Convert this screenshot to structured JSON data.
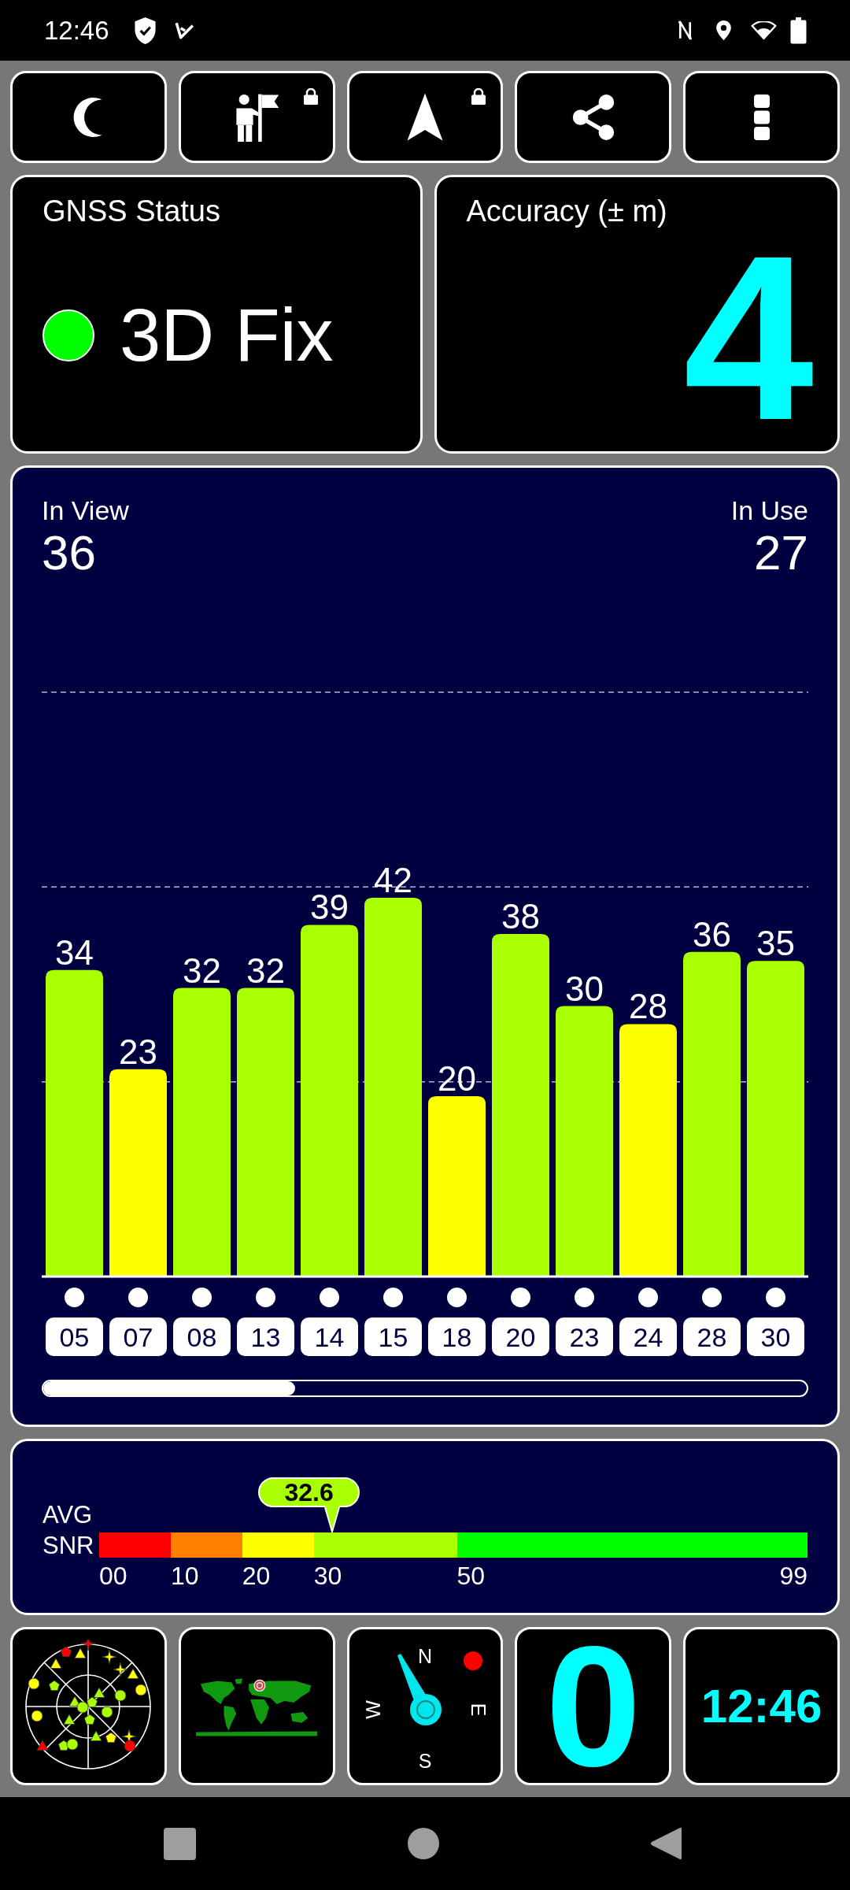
{
  "status_bar": {
    "time": "12:46"
  },
  "toolbar": [
    {
      "locked": false
    },
    {
      "locked": true
    },
    {
      "locked": true
    },
    {
      "locked": false
    },
    {
      "locked": false
    }
  ],
  "gnss_status": {
    "title": "GNSS Status",
    "value": "3D Fix",
    "color": "#00ff00"
  },
  "accuracy": {
    "title": "Accuracy (± m)",
    "value": "4"
  },
  "satellites": {
    "in_view_label": "In View",
    "in_view": "36",
    "in_use_label": "In Use",
    "in_use": "27",
    "chart_data": {
      "type": "bar",
      "categories": [
        "05",
        "07",
        "08",
        "13",
        "14",
        "15",
        "18",
        "20",
        "23",
        "24",
        "28",
        "30"
      ],
      "series": [
        {
          "color": "#aaff00",
          "values": [
            34,
            null,
            32,
            32,
            39,
            42,
            null,
            38,
            30,
            null,
            36,
            35
          ]
        },
        {
          "color": "#ffff00",
          "values": [
            null,
            23,
            null,
            null,
            null,
            null,
            20,
            null,
            null,
            28,
            null,
            null
          ]
        }
      ],
      "stacked": true,
      "data_labels": true,
      "ref_lines": [
        {
          "axis": "y",
          "value": 21.6
        },
        {
          "axis": "y",
          "value": 43.2
        },
        {
          "axis": "y",
          "value": 64.8
        }
      ]
    }
  },
  "snr": {
    "label": "AVG SNR",
    "average": {
      "value": "32.6",
      "level": 0.329
    },
    "scale": [
      {
        "color": "#ff0000"
      },
      {
        "color": "#ff8000"
      },
      {
        "color": "#ffff00"
      },
      {
        "color": "#aaff00"
      },
      {
        "color": "#00ff00"
      }
    ],
    "ticks": [
      "00",
      "10",
      "20",
      "30",
      "50",
      "99"
    ]
  },
  "tiles": [
    {
      "kind": "skyplot"
    },
    {
      "kind": "map"
    },
    {
      "kind": "compass",
      "labels": [
        "N",
        "E",
        "S",
        "W"
      ]
    },
    {
      "kind": "number",
      "value": "0"
    },
    {
      "kind": "clock",
      "value": "12:46"
    }
  ]
}
